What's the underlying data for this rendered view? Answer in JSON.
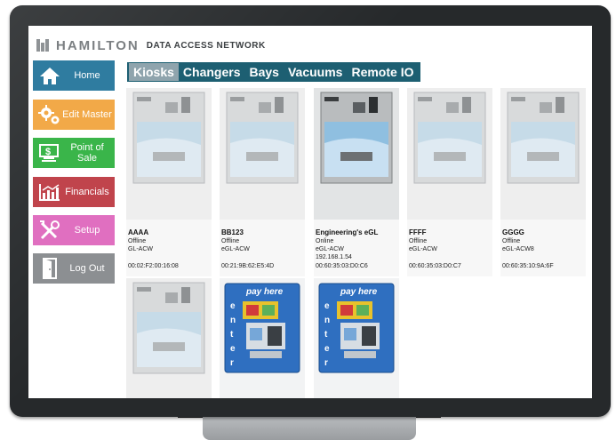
{
  "header": {
    "brand": "HAMILTON",
    "subtitle": "DATA ACCESS NETWORK"
  },
  "sidebar": {
    "items": [
      {
        "label": "Home",
        "color": "#2f7ca0"
      },
      {
        "label": "Edit Master",
        "color": "#f2a948"
      },
      {
        "label": "Point of Sale",
        "color": "#3ab54a"
      },
      {
        "label": "Financials",
        "color": "#c0444c"
      },
      {
        "label": "Setup",
        "color": "#e06fc0"
      },
      {
        "label": "Log Out",
        "color": "#8c8f92"
      }
    ]
  },
  "tabs": [
    {
      "label": "Kiosks",
      "active": true
    },
    {
      "label": "Changers",
      "active": false
    },
    {
      "label": "Bays",
      "active": false
    },
    {
      "label": "Vacuums",
      "active": false
    },
    {
      "label": "Remote IO",
      "active": false
    }
  ],
  "kiosks": [
    {
      "name": "AAAA",
      "status": "Offline",
      "model": "GL-ACW",
      "ip": "",
      "mac": "00:02:F2:00:16:08"
    },
    {
      "name": "BB123",
      "status": "Offline",
      "model": "eGL-ACW",
      "ip": "",
      "mac": "00:21:9B:62:E5:4D"
    },
    {
      "name": "Engineering's eGL",
      "status": "Online",
      "model": "eGL-ACW",
      "ip": "192.168.1.54",
      "mac": "00:60:35:03:D0:C6"
    },
    {
      "name": "FFFF",
      "status": "Offline",
      "model": "eGL-ACW",
      "ip": "",
      "mac": "00:60:35:03:D0:C7"
    },
    {
      "name": "GGGG",
      "status": "Offline",
      "model": "eGL-ACW8",
      "ip": "",
      "mac": "00:60:35:10:9A:6F"
    }
  ],
  "kiosk_banner": {
    "text": "pay here",
    "side": "enter"
  }
}
